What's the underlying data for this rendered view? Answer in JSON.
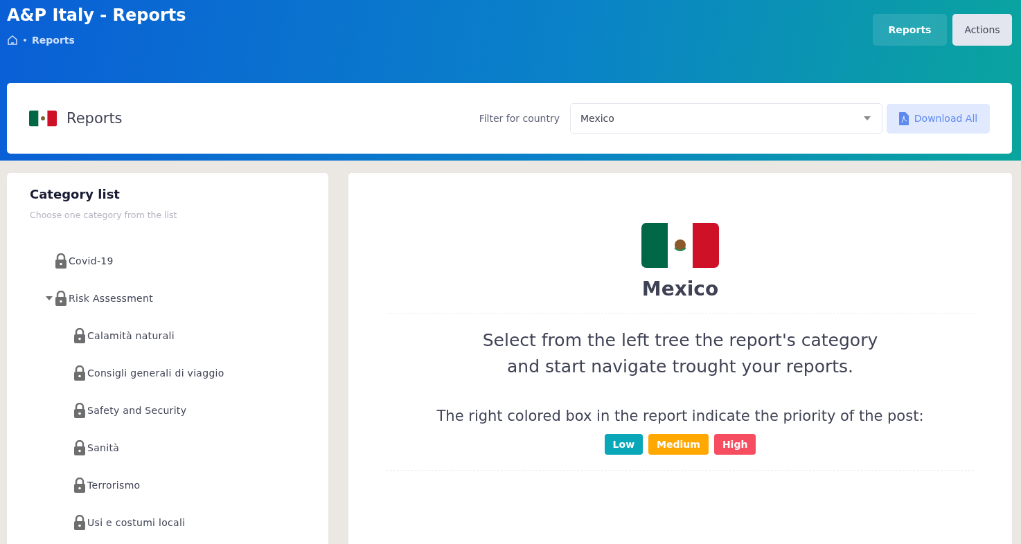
{
  "header": {
    "title": "A&P Italy - Reports",
    "breadcrumb": [
      "Reports"
    ],
    "buttons": [
      {
        "label": "Reports",
        "kind": "ghost"
      },
      {
        "label": "Actions",
        "kind": "light"
      }
    ]
  },
  "toolbar": {
    "title": "Reports",
    "filter_label": "Filter for country",
    "country_select": {
      "value": "Mexico"
    },
    "download_button": "Download All"
  },
  "sidebar": {
    "title": "Category list",
    "subtitle": "Choose one category from the list",
    "tree": [
      {
        "label": "Covid-19"
      },
      {
        "label": "Risk Assessment",
        "expanded": true,
        "children": [
          {
            "label": "Calamità naturali"
          },
          {
            "label": "Consigli generali di viaggio"
          },
          {
            "label": "Safety and Security"
          },
          {
            "label": "Sanità"
          },
          {
            "label": "Terrorismo"
          },
          {
            "label": "Usi e costumi locali"
          }
        ]
      }
    ]
  },
  "content": {
    "country": "Mexico",
    "message": "Select from the left tree the report's category and start navigate trought your reports.",
    "priority_text": "The right colored box in the report indicate the priority of the post:",
    "priorities": [
      {
        "label": "Low",
        "color": "#0aa7b8"
      },
      {
        "label": "Medium",
        "color": "#ffa800"
      },
      {
        "label": "High",
        "color": "#f64e60"
      }
    ]
  }
}
